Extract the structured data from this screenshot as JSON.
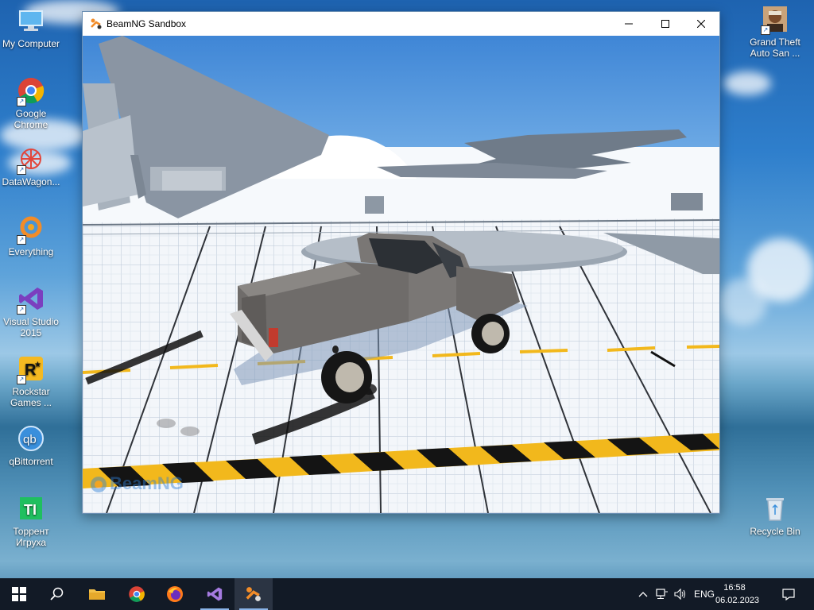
{
  "window": {
    "title": "BeamNG Sandbox",
    "watermark": "BeamNG"
  },
  "desktop": {
    "left_icons": [
      {
        "label": "My Computer"
      },
      {
        "label": "Google Chrome"
      },
      {
        "label": "DataWagon..."
      },
      {
        "label": "Everything"
      },
      {
        "label": "Visual Studio 2015"
      },
      {
        "label": "Rockstar Games ..."
      },
      {
        "label": "qBittorrent"
      },
      {
        "label": "Торрент Игруха"
      }
    ],
    "right_icons": [
      {
        "label": "Grand Theft Auto San ..."
      },
      {
        "label": "Recycle Bin"
      }
    ]
  },
  "taskbar": {
    "language": "ENG",
    "time": "16:58",
    "date": "06.02.2023"
  },
  "colors": {
    "taskbar_bg": "#121a26",
    "accent": "#8ab4e8",
    "hazard_yellow": "#f2b81c"
  }
}
